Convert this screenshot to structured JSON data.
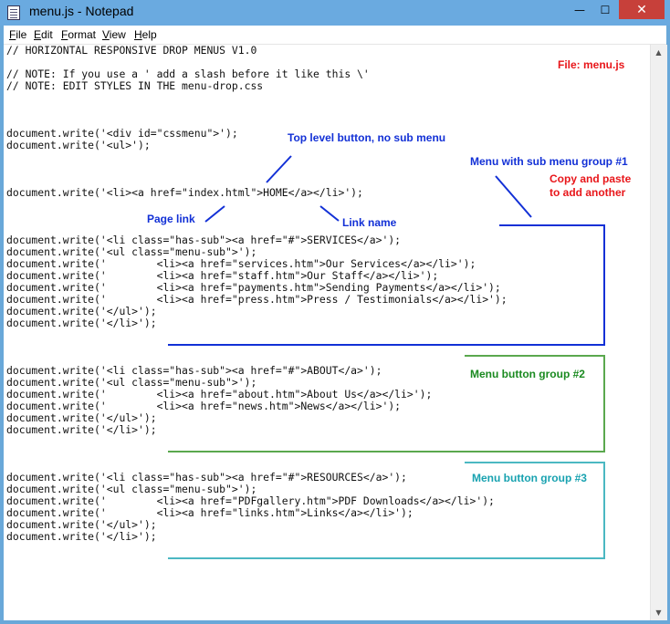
{
  "window": {
    "title": "menu.js - Notepad",
    "minimize_glyph": "—",
    "maximize_glyph": "☐",
    "close_glyph": "✕"
  },
  "menubar": {
    "items": [
      {
        "underline": "F",
        "rest": "ile"
      },
      {
        "underline": "E",
        "rest": "dit"
      },
      {
        "underline": "F",
        "rest": "ormat",
        "underline_index": 0
      },
      {
        "underline": "V",
        "rest": "iew"
      },
      {
        "underline": "H",
        "rest": "elp"
      }
    ]
  },
  "editor": {
    "lines": [
      "// HORIZONTAL RESPONSIVE DROP MENUS V1.0",
      "",
      "// NOTE: If you use a ' add a slash before it like this \\'",
      "// NOTE: EDIT STYLES IN THE menu-drop.css",
      "",
      "",
      "",
      "document.write('<div id=\"cssmenu\">');",
      "document.write('<ul>');",
      "",
      "",
      "",
      "document.write('<li><a href=\"index.html\">HOME</a></li>');",
      "",
      "",
      "",
      "document.write('<li class=\"has-sub\"><a href=\"#\">SERVICES</a>');",
      "document.write('<ul class=\"menu-sub\">');",
      "document.write('        <li><a href=\"services.htm\">Our Services</a></li>');",
      "document.write('        <li><a href=\"staff.htm\">Our Staff</a></li>');",
      "document.write('        <li><a href=\"payments.htm\">Sending Payments</a></li>');",
      "document.write('        <li><a href=\"press.htm\">Press / Testimonials</a></li>');",
      "document.write('</ul>');",
      "document.write('</li>');",
      "",
      "",
      "",
      "document.write('<li class=\"has-sub\"><a href=\"#\">ABOUT</a>');",
      "document.write('<ul class=\"menu-sub\">');",
      "document.write('        <li><a href=\"about.htm\">About Us</a></li>');",
      "document.write('        <li><a href=\"news.htm\">News</a></li>');",
      "document.write('</ul>');",
      "document.write('</li>');",
      "",
      "",
      "",
      "document.write('<li class=\"has-sub\"><a href=\"#\">RESOURCES</a>');",
      "document.write('<ul class=\"menu-sub\">');",
      "document.write('        <li><a href=\"PDFgallery.htm\">PDF Downloads</a></li>');",
      "document.write('        <li><a href=\"links.htm\">Links</a></li>');",
      "document.write('</ul>');",
      "document.write('</li>');"
    ]
  },
  "annotations": {
    "file_label": "File: menu.js",
    "top_level": "Top level button, no sub menu",
    "sub_menu_group1": "Menu with sub menu group #1",
    "copy_paste_1": "Copy and paste",
    "copy_paste_2": "to add another",
    "page_link": "Page link",
    "link_name": "Link name",
    "group2": "Menu button group #2",
    "group3": "Menu button group #3"
  },
  "colors": {
    "annotation_blue": "#1230d6",
    "annotation_red": "#e8161a",
    "group2_green": "#5aa84e",
    "group3_teal": "#4bb8c2"
  }
}
